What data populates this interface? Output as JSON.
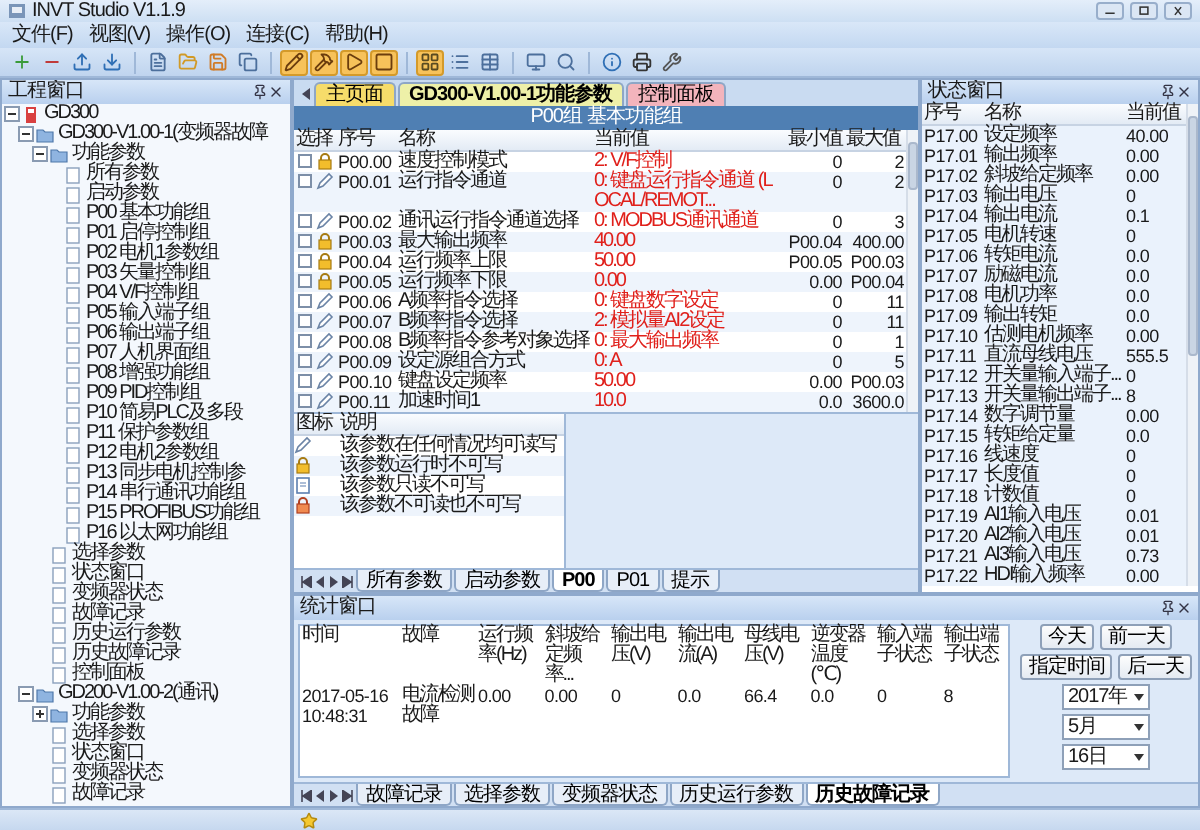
{
  "window": {
    "title": "INVT Studio V1.1.9"
  },
  "menu": [
    "文件(F)",
    "视图(V)",
    "操作(O)",
    "连接(C)",
    "帮助(H)"
  ],
  "project_panel": {
    "title": "工程窗口",
    "tree": [
      {
        "label": "GD300",
        "expanded": true,
        "children": [
          {
            "label": "GD300-V1.00-1(变频器故障",
            "expanded": true,
            "children": [
              {
                "label": "功能参数",
                "expanded": true,
                "children": [
                  {
                    "label": "所有参数"
                  },
                  {
                    "label": "启动参数"
                  },
                  {
                    "label": "P00 基本功能组"
                  },
                  {
                    "label": "P01 启停控制组"
                  },
                  {
                    "label": "P02 电机1参数组"
                  },
                  {
                    "label": "P03 矢量控制组"
                  },
                  {
                    "label": "P04 V/F控制组"
                  },
                  {
                    "label": "P05 输入端子组"
                  },
                  {
                    "label": "P06 输出端子组"
                  },
                  {
                    "label": "P07 人机界面组"
                  },
                  {
                    "label": "P08 增强功能组"
                  },
                  {
                    "label": "P09 PID控制组"
                  },
                  {
                    "label": "P10 简易PLC及多段"
                  },
                  {
                    "label": "P11 保护参数组"
                  },
                  {
                    "label": "P12 电机2参数组"
                  },
                  {
                    "label": "P13 同步电机控制参"
                  },
                  {
                    "label": "P14 串行通讯功能组"
                  },
                  {
                    "label": "P15 PROFIBUS功能组"
                  },
                  {
                    "label": "P16 以太网功能组"
                  }
                ]
              },
              {
                "label": "选择参数"
              },
              {
                "label": "状态窗口"
              },
              {
                "label": "变频器状态"
              },
              {
                "label": "故障记录"
              },
              {
                "label": "历史运行参数"
              },
              {
                "label": "历史故障记录"
              },
              {
                "label": "控制面板"
              }
            ]
          },
          {
            "label": "GD200-V1.00-2(通讯)",
            "expanded": true,
            "children": [
              {
                "label": "功能参数",
                "expanded": false
              },
              {
                "label": "选择参数"
              },
              {
                "label": "状态窗口"
              },
              {
                "label": "变频器状态"
              },
              {
                "label": "故障记录"
              }
            ]
          }
        ]
      }
    ]
  },
  "doc_tabs": [
    {
      "label": "主页面",
      "selected": false,
      "color": "#f6dc6a"
    },
    {
      "label": "GD300-V1.00-1功能参数",
      "selected": true,
      "color": "#eef0a8"
    },
    {
      "label": "控制面板",
      "selected": false,
      "color": "#f3b4bc"
    }
  ],
  "param_group": {
    "title": "P00组 基本功能组",
    "columns": [
      "选择",
      "序号",
      "名称",
      "当前值",
      "最小值",
      "最大值"
    ],
    "rows": [
      {
        "checked": false,
        "kind": "locked",
        "code": "P00.00",
        "name": "速度控制模式",
        "value": "2: V/F控制",
        "min": "0",
        "max": "2"
      },
      {
        "checked": false,
        "kind": "writable",
        "code": "P00.01",
        "name": "运行指令通道",
        "value": "0: 键盘运行指令通道 (LOCAL/REMOT...",
        "min": "0",
        "max": "2"
      },
      {
        "checked": false,
        "kind": "writable",
        "code": "P00.02",
        "name": "通讯运行指令通道选择",
        "value": "0: MODBUS通讯通道",
        "min": "0",
        "max": "3"
      },
      {
        "checked": false,
        "kind": "locked",
        "code": "P00.03",
        "name": "最大输出频率",
        "value": "40.00",
        "min": "P00.04",
        "max": "400.00"
      },
      {
        "checked": false,
        "kind": "locked",
        "code": "P00.04",
        "name": "运行频率上限",
        "value": "50.00",
        "min": "P00.05",
        "max": "P00.03"
      },
      {
        "checked": false,
        "kind": "locked",
        "code": "P00.05",
        "name": "运行频率下限",
        "value": "0.00",
        "min": "0.00",
        "max": "P00.04"
      },
      {
        "checked": false,
        "kind": "writable",
        "code": "P00.06",
        "name": "A频率指令选择",
        "value": "0: 键盘数字设定",
        "min": "0",
        "max": "11"
      },
      {
        "checked": false,
        "kind": "writable",
        "code": "P00.07",
        "name": "B频率指令选择",
        "value": "2: 模拟量AI2设定",
        "min": "0",
        "max": "11"
      },
      {
        "checked": false,
        "kind": "writable",
        "code": "P00.08",
        "name": "B频率指令参考对象选择",
        "value": "0: 最大输出频率",
        "min": "0",
        "max": "1"
      },
      {
        "checked": false,
        "kind": "writable",
        "code": "P00.09",
        "name": "设定源组合方式",
        "value": "0: A",
        "min": "0",
        "max": "5"
      },
      {
        "checked": false,
        "kind": "writable",
        "code": "P00.10",
        "name": "键盘设定频率",
        "value": "50.00",
        "min": "0.00",
        "max": "P00.03"
      },
      {
        "checked": false,
        "kind": "writable",
        "code": "P00.11",
        "name": "加速时间1",
        "value": "10.0",
        "min": "0.0",
        "max": "3600.0"
      }
    ]
  },
  "legend": {
    "columns": [
      "图标",
      "说明"
    ],
    "items": [
      {
        "kind": "writable",
        "text": "该参数在任何情况均可读写"
      },
      {
        "kind": "locked",
        "text": "该参数运行时不可写"
      },
      {
        "kind": "readonly",
        "text": "该参数只读不可写"
      },
      {
        "kind": "hidden",
        "text": "该参数不可读也不可写"
      }
    ]
  },
  "group_tabs": [
    {
      "label": "所有参数",
      "selected": false
    },
    {
      "label": "启动参数",
      "selected": false
    },
    {
      "label": "P00",
      "selected": true
    },
    {
      "label": "P01",
      "selected": false
    },
    {
      "label": "提示",
      "selected": false
    }
  ],
  "status_panel": {
    "title": "状态窗口",
    "columns": [
      "序号",
      "名称",
      "当前值"
    ],
    "rows": [
      {
        "code": "P17.00",
        "name": "设定频率",
        "value": "40.00"
      },
      {
        "code": "P17.01",
        "name": "输出频率",
        "value": "0.00"
      },
      {
        "code": "P17.02",
        "name": "斜坡给定频率",
        "value": "0.00"
      },
      {
        "code": "P17.03",
        "name": "输出电压",
        "value": "0"
      },
      {
        "code": "P17.04",
        "name": "输出电流",
        "value": "0.1"
      },
      {
        "code": "P17.05",
        "name": "电机转速",
        "value": "0"
      },
      {
        "code": "P17.06",
        "name": "转矩电流",
        "value": "0.0"
      },
      {
        "code": "P17.07",
        "name": "励磁电流",
        "value": "0.0"
      },
      {
        "code": "P17.08",
        "name": "电机功率",
        "value": "0.0"
      },
      {
        "code": "P17.09",
        "name": "输出转矩",
        "value": "0.0"
      },
      {
        "code": "P17.10",
        "name": "估测电机频率",
        "value": "0.00"
      },
      {
        "code": "P17.11",
        "name": "直流母线电压",
        "value": "555.5"
      },
      {
        "code": "P17.12",
        "name": "开关量输入端子...",
        "value": "0"
      },
      {
        "code": "P17.13",
        "name": "开关量输出端子...",
        "value": "8"
      },
      {
        "code": "P17.14",
        "name": "数字调节量",
        "value": "0.00"
      },
      {
        "code": "P17.15",
        "name": "转矩给定量",
        "value": "0.0"
      },
      {
        "code": "P17.16",
        "name": "线速度",
        "value": "0"
      },
      {
        "code": "P17.17",
        "name": "长度值",
        "value": "0"
      },
      {
        "code": "P17.18",
        "name": "计数值",
        "value": "0"
      },
      {
        "code": "P17.19",
        "name": "AI1输入电压",
        "value": "0.01"
      },
      {
        "code": "P17.20",
        "name": "AI2输入电压",
        "value": "0.01"
      },
      {
        "code": "P17.21",
        "name": "AI3输入电压",
        "value": "0.73"
      },
      {
        "code": "P17.22",
        "name": "HDI输入频率",
        "value": "0.00"
      }
    ]
  },
  "stats_panel": {
    "title": "统计窗口",
    "columns": [
      "时间",
      "故障",
      "运行频率(Hz)",
      "斜坡给定频率...",
      "输出电压(V)",
      "输出电流(A)",
      "母线电压(V)",
      "逆变器温度(℃)",
      "输入端子状态",
      "输出端子状态"
    ],
    "rows": [
      [
        "2017-05-16 10:48:31",
        "电流检测故障",
        "0.00",
        "0.00",
        "0",
        "0.0",
        "66.4",
        "0.0",
        "0",
        "8"
      ]
    ],
    "buttons": [
      "今天",
      "前一天",
      "指定时间",
      "后一天"
    ],
    "selects": [
      "2017年",
      "5月",
      "16日"
    ],
    "tabs": [
      {
        "label": "故障记录",
        "selected": false
      },
      {
        "label": "选择参数",
        "selected": false
      },
      {
        "label": "变频器状态",
        "selected": false
      },
      {
        "label": "历史运行参数",
        "selected": false
      },
      {
        "label": "历史故障记录",
        "selected": true
      }
    ]
  }
}
